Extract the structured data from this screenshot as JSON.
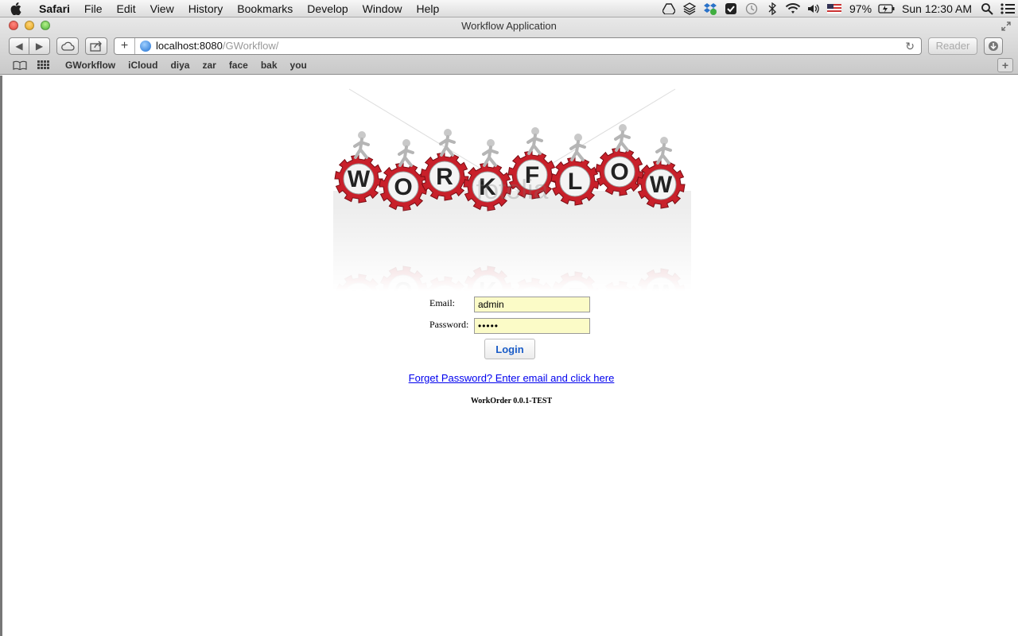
{
  "menubar": {
    "app_name": "Safari",
    "items": [
      "File",
      "Edit",
      "View",
      "History",
      "Bookmarks",
      "Develop",
      "Window",
      "Help"
    ],
    "battery": "97%",
    "clock": "Sun 12:30 AM",
    "tray_icons": [
      "drive-icon",
      "layers-icon",
      "dropbox-icon",
      "evernote-icon",
      "time-machine-icon",
      "bluetooth-icon",
      "wifi-icon",
      "volume-icon",
      "us-flag-icon",
      "battery-icon",
      "spotlight-icon",
      "notification-list-icon"
    ]
  },
  "window": {
    "title": "Workflow Application"
  },
  "toolbar": {
    "url_host": "localhost:8080",
    "url_path": "/GWorkflow/",
    "reader_label": "Reader"
  },
  "bookmarks": [
    "GWorkflow",
    "iCloud",
    "diya",
    "zar",
    "face",
    "bak",
    "you"
  ],
  "logo": {
    "letters": [
      "W",
      "O",
      "R",
      "K",
      "F",
      "L",
      "O",
      "W"
    ],
    "watermark": "fotolia",
    "gear_color": "#c8202a"
  },
  "form": {
    "email_label": "Email:",
    "email_value": "admin",
    "password_label": "Password:",
    "password_value": "•••••",
    "login_label": "Login",
    "forgot_link": "Forget Password? Enter email and click here",
    "version": "WorkOrder 0.0.1-TEST"
  }
}
